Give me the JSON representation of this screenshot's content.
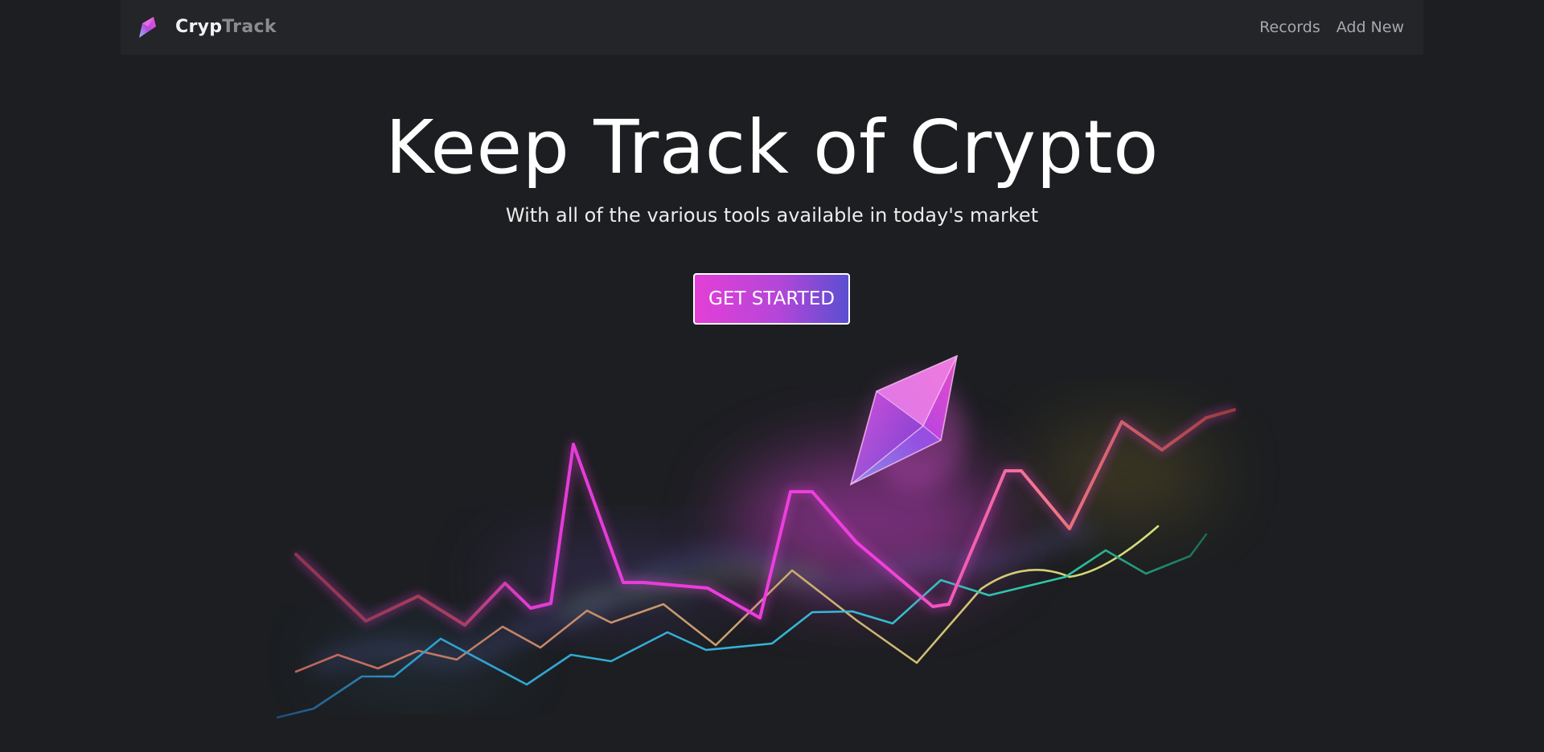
{
  "nav": {
    "brand_part1": "Cryp",
    "brand_part2": "Track",
    "links": [
      {
        "label": "Records"
      },
      {
        "label": "Add New"
      }
    ]
  },
  "hero": {
    "title": "Keep Track of Crypto",
    "subtitle": "With all of the various tools available in today's market",
    "cta_label": "GET STARTED"
  },
  "colors": {
    "page_background": "#1c1e21",
    "navbar_background": "#232529",
    "cta_gradient_start": "#e33fd6",
    "cta_gradient_end": "#5a4fd0",
    "line_magenta": "#e83cd8",
    "line_cyan": "#34b6d6",
    "line_teal": "#2ec4a0",
    "line_tan": "#c8a070",
    "line_salmon": "#f47a6a"
  },
  "icons": {
    "brand_logo": "crypto-crystal-icon",
    "illustration_crystal": "crystal-gem-icon"
  }
}
